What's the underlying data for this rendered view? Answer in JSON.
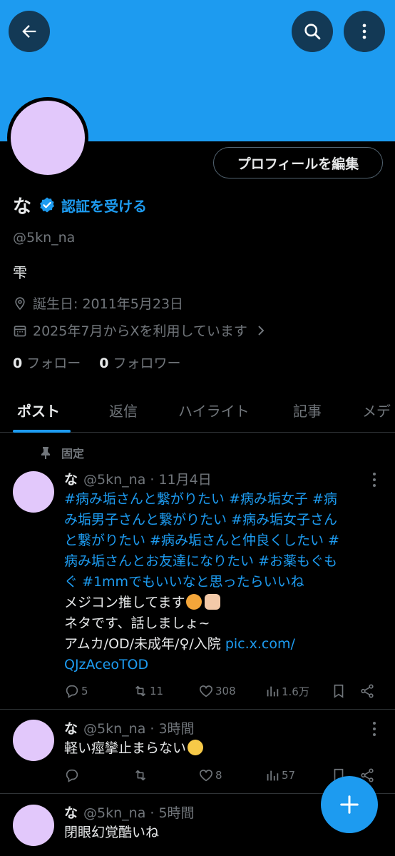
{
  "colors": {
    "accent": "#1d9bf0",
    "banner": "#1d9bf0",
    "avatar": "#e2c8fb",
    "muted": "#71767b",
    "text": "#e7e9ea"
  },
  "header": {
    "back_icon": "arrow-left-icon",
    "search_icon": "search-icon",
    "more_icon": "more-vertical-icon"
  },
  "profile": {
    "edit_label": "プロフィールを編集",
    "name": "な",
    "verify_label": "認証を受ける",
    "handle": "@5kn_na",
    "bio": "雫",
    "birthday": "誕生日: 2011年5月23日",
    "joined": "2025年7月からXを利用しています",
    "following_count": "0",
    "following_label": "フォロー",
    "followers_count": "0",
    "followers_label": "フォロワー"
  },
  "tabs": [
    {
      "label": "ポスト",
      "active": true
    },
    {
      "label": "返信"
    },
    {
      "label": "ハイライト"
    },
    {
      "label": "記事"
    },
    {
      "label": "メデ"
    }
  ],
  "pinned_label": "固定",
  "posts": [
    {
      "name": "な",
      "meta": "@5kn_na · 11月4日",
      "lines": [
        "#病み垢さんと繋がりたい #病み垢女子 #病",
        "み垢男子さんと繋がりたい #病み垢女子さん",
        "と繋がりたい #病み垢さんと仲良くしたい #",
        "病み垢さんとお友達になりたい #お薬もぐも",
        "ぐ #1mmでもいいなと思ったらいいね",
        "メジコン推してます",
        "ネタです、話しましょ~",
        "アムカ/OD/未成年/♀/入院 ",
        "QJzAceoTOD"
      ],
      "link_part": "pic.x.com/",
      "replies": "5",
      "reposts": "11",
      "likes": "308",
      "views": "1.6万"
    },
    {
      "name": "な",
      "meta": "@5kn_na · 3時間",
      "lines": [
        "軽い痙攣止まらない"
      ],
      "replies": "",
      "reposts": "",
      "likes": "8",
      "views": "57"
    },
    {
      "name": "な",
      "meta": "@5kn_na · 5時間",
      "lines": [
        "閉眼幻覚酷いね"
      ]
    }
  ],
  "fab_icon": "plus-icon"
}
